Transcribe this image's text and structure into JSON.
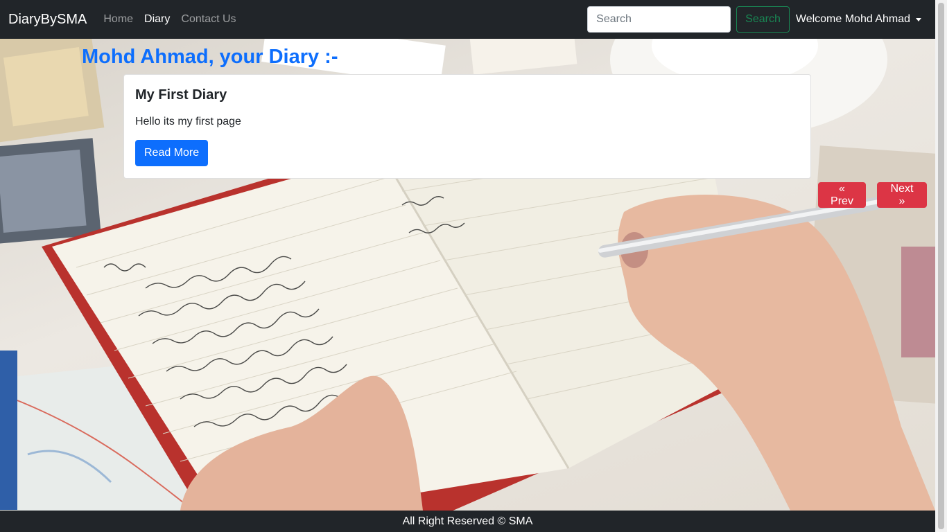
{
  "navbar": {
    "brand": "DiaryBySMA",
    "links": [
      {
        "label": "Home",
        "active": false
      },
      {
        "label": "Diary",
        "active": true
      },
      {
        "label": "Contact Us",
        "active": false
      }
    ],
    "search": {
      "placeholder": "Search",
      "value": "",
      "button_label": "Search"
    },
    "user_menu_label": "Welcome Mohd Ahmad"
  },
  "main": {
    "heading": "Mohd Ahmad, your Diary :-",
    "card": {
      "title": "My First Diary",
      "text": "Hello its my first page",
      "button_label": "Read More"
    },
    "pagination": {
      "prev_label": "« Prev",
      "next_label": "Next »"
    }
  },
  "footer": {
    "text": "All Right Reserved © SMA"
  },
  "colors": {
    "navbar_bg": "#212529",
    "primary": "#0d6efd",
    "success": "#198754",
    "danger": "#dc3545"
  },
  "icons": {
    "user_dropdown": "caret-down-icon"
  }
}
